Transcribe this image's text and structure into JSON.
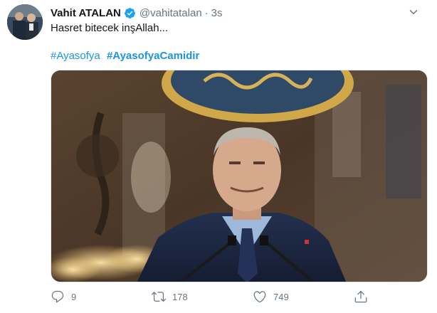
{
  "tweet": {
    "author_name": "Vahit ATALAN",
    "handle": "@vahitatalan",
    "separator": "·",
    "time": "3s",
    "text": "Hasret bitecek inşAllah...",
    "hashtags": [
      "#Ayasofya",
      "#AyasofyaCamidir"
    ]
  },
  "actions": {
    "reply_count": "9",
    "retweet_count": "178",
    "like_count": "749"
  },
  "colors": {
    "link": "#1b95e0",
    "secondary_text": "#657786",
    "verified": "#1da1f2"
  },
  "icons": [
    "verified-badge-icon",
    "chevron-down-icon",
    "reply-icon",
    "retweet-icon",
    "like-icon",
    "share-icon"
  ]
}
